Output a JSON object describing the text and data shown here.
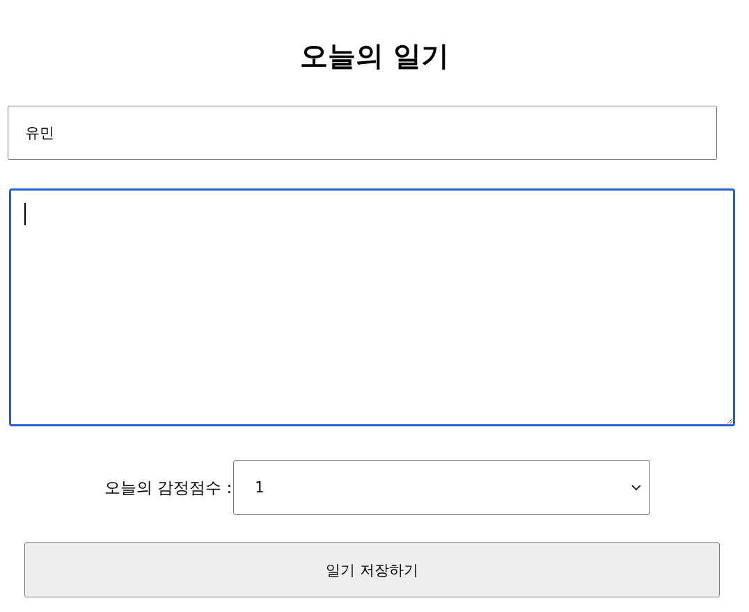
{
  "title": "오늘의 일기",
  "author_field": {
    "value": "유민"
  },
  "content_field": {
    "focused": true
  },
  "score": {
    "label": "오늘의 감정점수 :",
    "value": "1"
  },
  "save_button": {
    "label": "일기 저장하기"
  }
}
